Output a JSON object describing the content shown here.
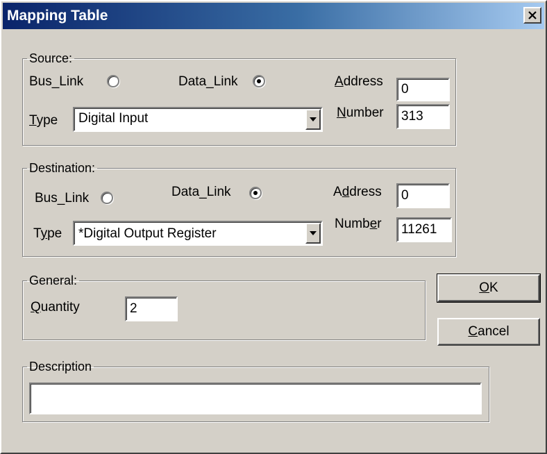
{
  "window": {
    "title": "Mapping Table"
  },
  "source": {
    "legend": "Source:",
    "bus_link_label": "Bus_Link",
    "bus_link_selected": false,
    "data_link_label": "Data_Link",
    "data_link_selected": true,
    "address_label_mnemonic": "A",
    "address_label_rest": "ddress",
    "address_value": "0",
    "type_label_mnemonic": "T",
    "type_label_rest": "ype",
    "type_value": "Digital Input",
    "number_label_mnemonic": "N",
    "number_label_rest": "umber",
    "number_value": "313"
  },
  "destination": {
    "legend": "Destination:",
    "bus_link_label": "Bus_Link",
    "bus_link_selected": false,
    "data_link_label": "Data_Link",
    "data_link_selected": true,
    "address_label_pre": "A",
    "address_label_mnemonic": "d",
    "address_label_rest": "dress",
    "address_value": "0",
    "type_label_pre": "T",
    "type_label_mnemonic": "y",
    "type_label_rest": "pe",
    "type_value": "*Digital Output Register",
    "number_label_pre": "Numb",
    "number_label_mnemonic": "e",
    "number_label_rest": "r",
    "number_value": "11261"
  },
  "general": {
    "legend": "General:",
    "quantity_label_mnemonic": "Q",
    "quantity_label_rest": "uantity",
    "quantity_value": "2"
  },
  "buttons": {
    "ok_mnemonic": "O",
    "ok_rest": "K",
    "cancel_mnemonic": "C",
    "cancel_rest": "ancel"
  },
  "description": {
    "legend": "Description",
    "value": ""
  }
}
